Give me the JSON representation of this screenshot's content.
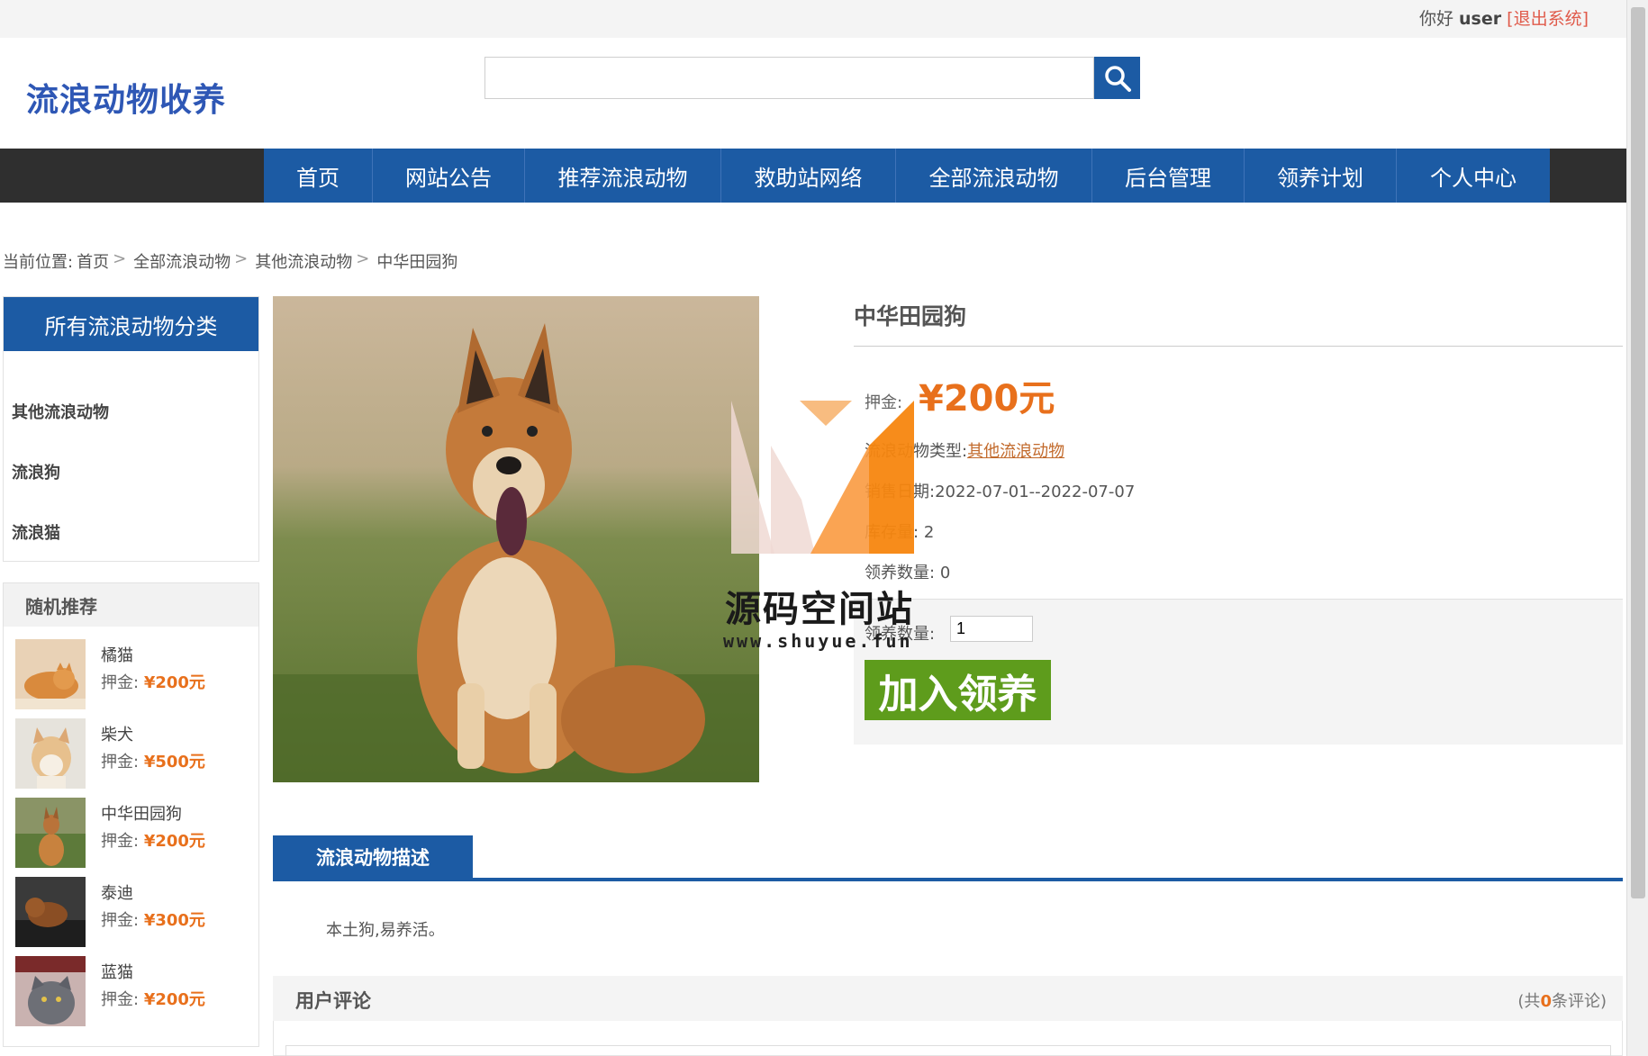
{
  "topbar": {
    "greeting": "你好",
    "username": "user",
    "logout": "[退出系统]"
  },
  "header": {
    "logo": "流浪动物收养",
    "search_placeholder": ""
  },
  "nav": {
    "items": [
      "首页",
      "网站公告",
      "推荐流浪动物",
      "救助站网络",
      "全部流浪动物",
      "后台管理",
      "领养计划",
      "个人中心"
    ]
  },
  "breadcrumb": {
    "prefix": "当前位置:",
    "items": [
      "首页",
      "全部流浪动物",
      "其他流浪动物",
      "中华田园狗"
    ]
  },
  "sidebar": {
    "categories_title": "所有流浪动物分类",
    "categories": [
      "其他流浪动物",
      "流浪狗",
      "流浪猫"
    ],
    "recommend_title": "随机推荐",
    "price_label": "押金:",
    "recommend": [
      {
        "name": "橘猫",
        "price": "¥200元"
      },
      {
        "name": "柴犬",
        "price": "¥500元"
      },
      {
        "name": "中华田园狗",
        "price": "¥200元"
      },
      {
        "name": "泰迪",
        "price": "¥300元"
      },
      {
        "name": "蓝猫",
        "price": "¥200元"
      }
    ]
  },
  "product": {
    "title": "中华田园狗",
    "deposit_label": "押金:",
    "deposit_value": "¥200元",
    "type_label": "流浪动物类型:",
    "type_value": "其他流浪动物",
    "date_label": "销售日期:",
    "date_value": "2022-07-01--2022-07-07",
    "stock_label": "库存量:",
    "stock_value": "2",
    "adopted_label": "领养数量:",
    "adopted_value": "0",
    "qty_label": "领养数量:",
    "qty_value": "1",
    "add_button": "加入领养"
  },
  "watermark": {
    "line1": "源码空间站",
    "line2": "www.shuyue.fun"
  },
  "description": {
    "tab": "流浪动物描述",
    "text": "本土狗,易养活。"
  },
  "comments": {
    "title": "用户评论",
    "count_prefix": "(共",
    "count": "0",
    "count_suffix": "条评论)"
  }
}
